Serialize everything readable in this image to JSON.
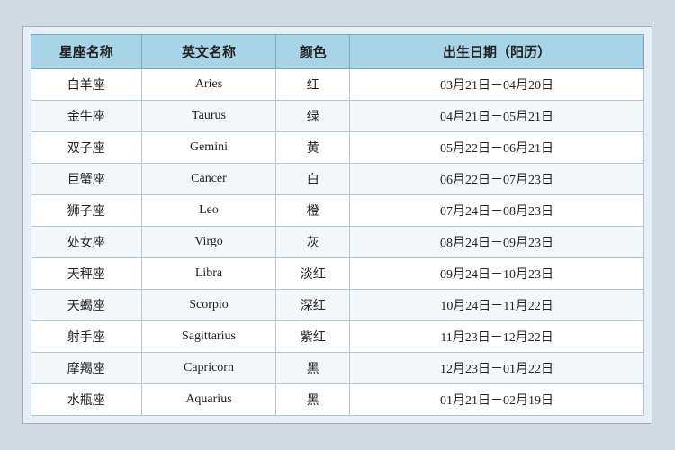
{
  "table": {
    "headers": {
      "chinese_name": "星座名称",
      "english_name": "英文名称",
      "color": "颜色",
      "date": "出生日期（阳历）"
    },
    "rows": [
      {
        "chinese": "白羊座",
        "english": "Aries",
        "color": "红",
        "date": "03月21日－04月20日"
      },
      {
        "chinese": "金牛座",
        "english": "Taurus",
        "color": "绿",
        "date": "04月21日－05月21日"
      },
      {
        "chinese": "双子座",
        "english": "Gemini",
        "color": "黄",
        "date": "05月22日－06月21日"
      },
      {
        "chinese": "巨蟹座",
        "english": "Cancer",
        "color": "白",
        "date": "06月22日－07月23日"
      },
      {
        "chinese": "狮子座",
        "english": "Leo",
        "color": "橙",
        "date": "07月24日－08月23日"
      },
      {
        "chinese": "处女座",
        "english": "Virgo",
        "color": "灰",
        "date": "08月24日－09月23日"
      },
      {
        "chinese": "天秤座",
        "english": "Libra",
        "color": "淡红",
        "date": "09月24日－10月23日"
      },
      {
        "chinese": "天蝎座",
        "english": "Scorpio",
        "color": "深红",
        "date": "10月24日－11月22日"
      },
      {
        "chinese": "射手座",
        "english": "Sagittarius",
        "color": "紫红",
        "date": "11月23日－12月22日"
      },
      {
        "chinese": "摩羯座",
        "english": "Capricorn",
        "color": "黑",
        "date": "12月23日－01月22日"
      },
      {
        "chinese": "水瓶座",
        "english": "Aquarius",
        "color": "黑",
        "date": "01月21日－02月19日"
      }
    ]
  }
}
